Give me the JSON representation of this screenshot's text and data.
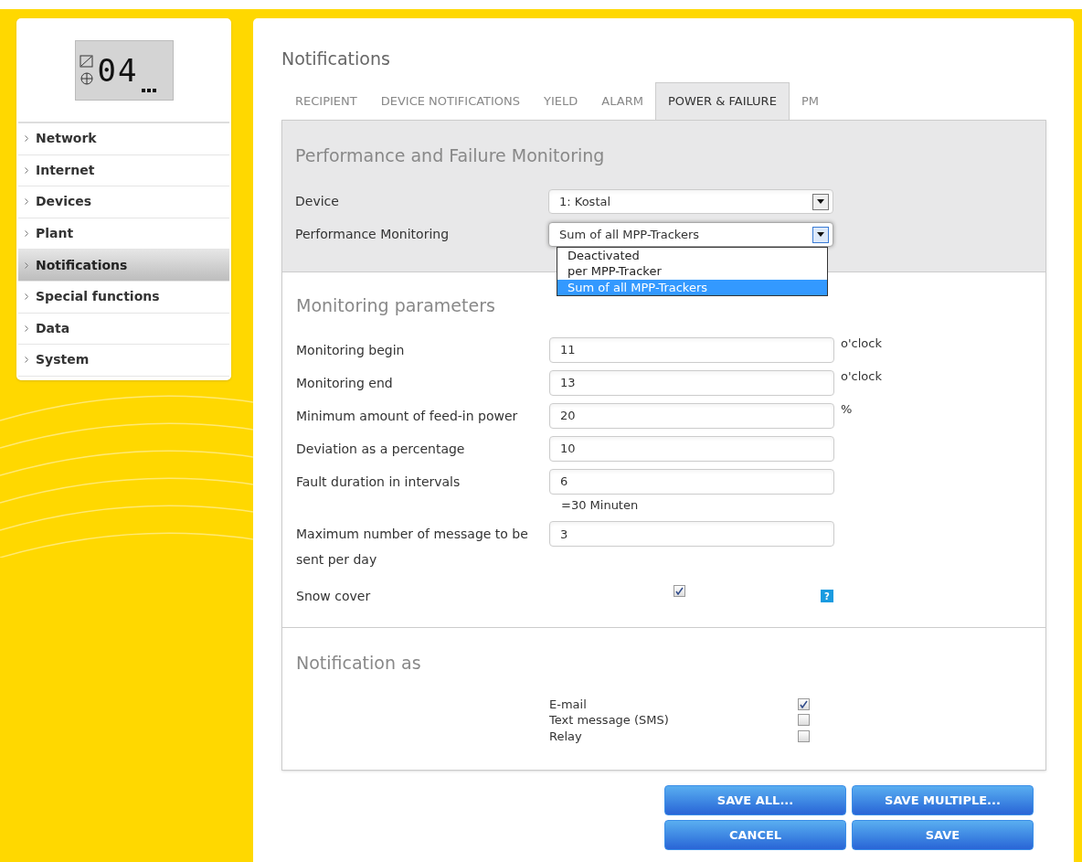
{
  "display": {
    "reading": "04"
  },
  "sidebar": {
    "items": [
      {
        "label": "Network",
        "selected": false
      },
      {
        "label": "Internet",
        "selected": false
      },
      {
        "label": "Devices",
        "selected": false
      },
      {
        "label": "Plant",
        "selected": false
      },
      {
        "label": "Notifications",
        "selected": true
      },
      {
        "label": "Special functions",
        "selected": false
      },
      {
        "label": "Data",
        "selected": false
      },
      {
        "label": "System",
        "selected": false
      }
    ]
  },
  "page_title": "Notifications",
  "tabs": [
    {
      "label": "RECIPIENT",
      "selected": false
    },
    {
      "label": "DEVICE NOTIFICATIONS",
      "selected": false
    },
    {
      "label": "YIELD",
      "selected": false
    },
    {
      "label": "ALARM",
      "selected": false
    },
    {
      "label": "POWER & FAILURE",
      "selected": true
    },
    {
      "label": "PM",
      "selected": false
    }
  ],
  "monitoring": {
    "title": "Performance and Failure Monitoring",
    "selects": [
      {
        "label": "Device",
        "value": "1: Kostal",
        "expanded": false
      },
      {
        "label": "Performance Monitoring",
        "value": "Sum of all MPP-Trackers",
        "expanded": true,
        "options": [
          {
            "label": "Deactivated",
            "selected": false
          },
          {
            "label": "per MPP-Tracker",
            "selected": false
          },
          {
            "label": "Sum of all MPP-Trackers",
            "selected": true
          }
        ]
      }
    ]
  },
  "parameters": {
    "title": "Monitoring parameters",
    "fields": [
      {
        "kind": "input",
        "label": "Monitoring begin",
        "value": "11",
        "suffix": "o'clock"
      },
      {
        "kind": "input",
        "label": "Monitoring end",
        "value": "13",
        "suffix": "o'clock"
      },
      {
        "kind": "input",
        "label": "Minimum amount of feed-in power",
        "value": "20",
        "suffix": "%"
      },
      {
        "kind": "input",
        "label": "Deviation as a percentage",
        "value": "10"
      },
      {
        "kind": "input",
        "label": "Fault duration in intervals",
        "value": "6",
        "note": "=30 Minuten"
      },
      {
        "kind": "input",
        "label": "Maximum number of message to be sent per day",
        "value": "3"
      },
      {
        "kind": "checkbox",
        "label": "Snow cover",
        "checked": true,
        "help": "?"
      }
    ]
  },
  "notification": {
    "title": "Notification as",
    "options": [
      {
        "label": "E-mail",
        "checked": true
      },
      {
        "label": "Text message (SMS)",
        "checked": false
      },
      {
        "label": "Relay",
        "checked": false
      }
    ]
  },
  "buttons": [
    "SAVE ALL...",
    "SAVE MULTIPLE...",
    "CANCEL",
    "SAVE"
  ]
}
